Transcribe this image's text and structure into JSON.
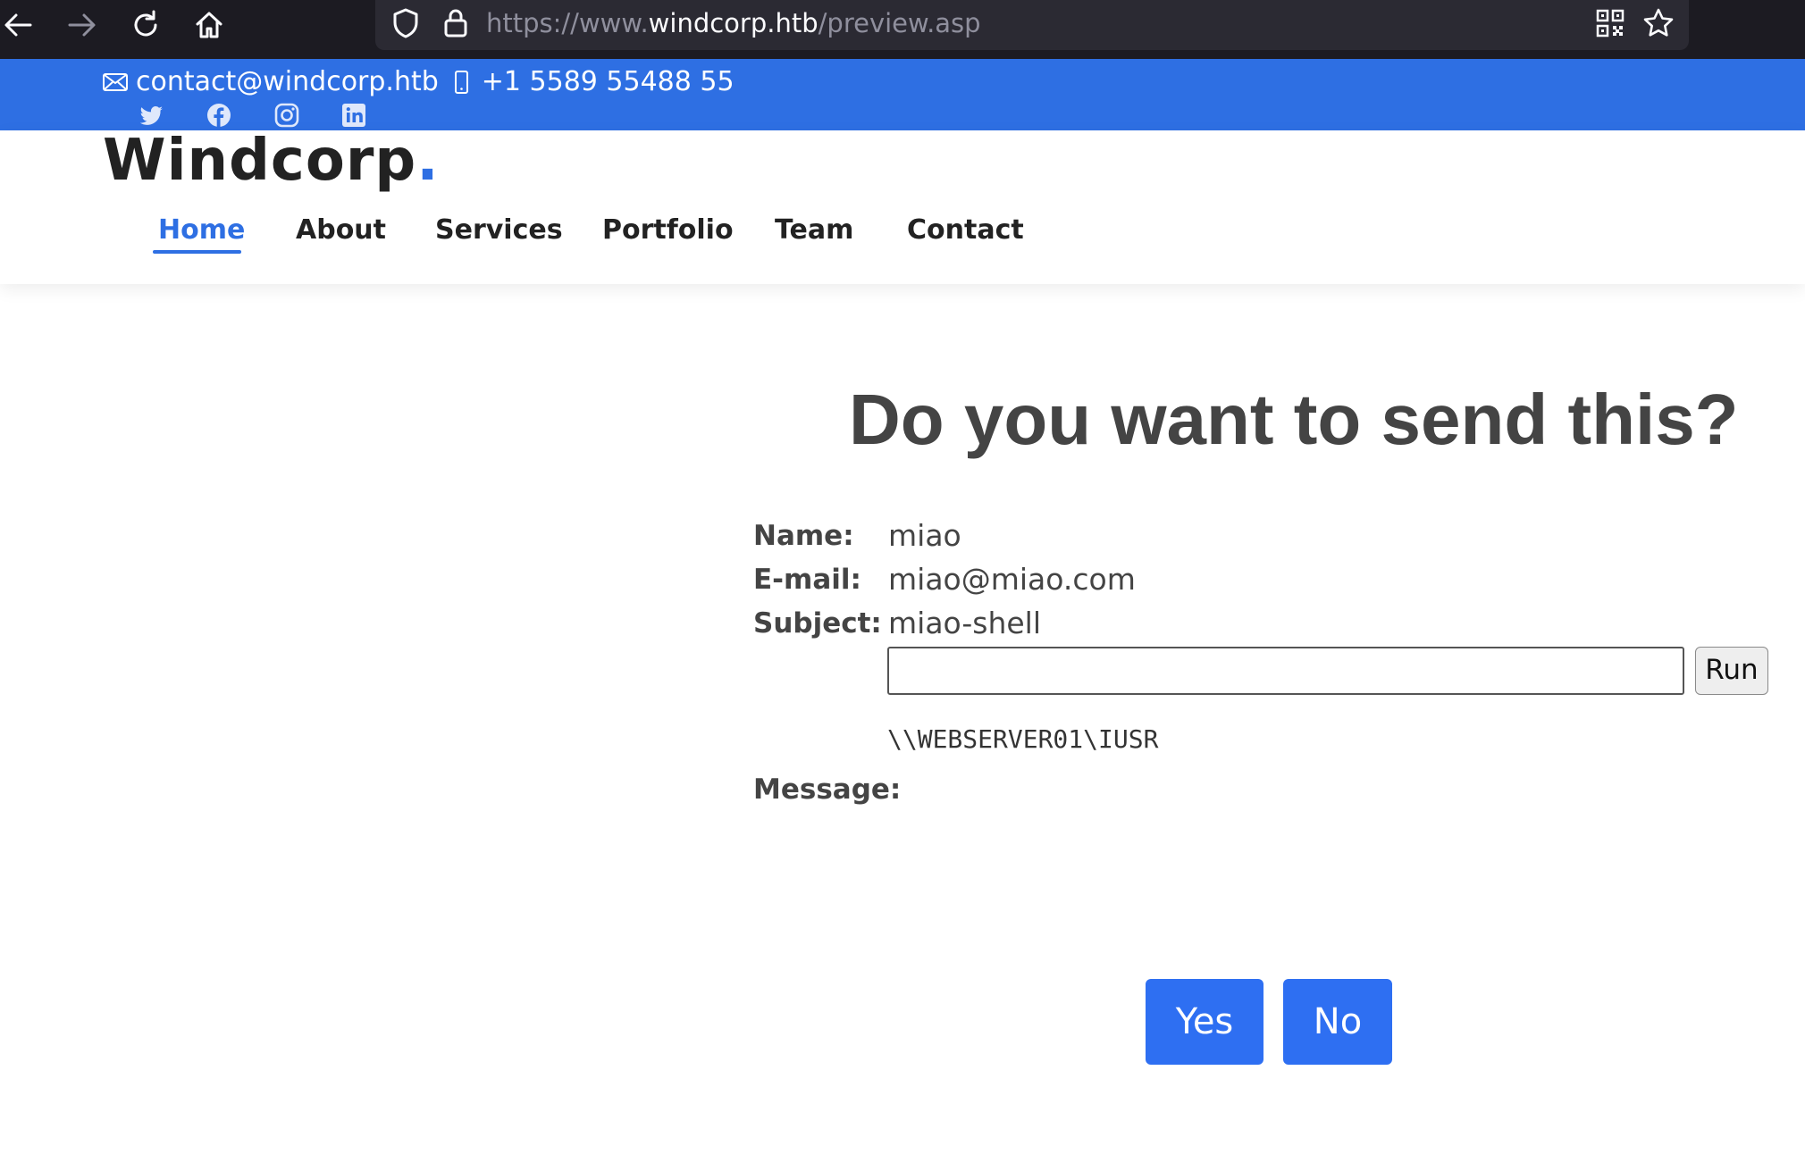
{
  "browser": {
    "url_prefix": "https://www.",
    "url_host": "windcorp.htb",
    "url_path": "/preview.asp"
  },
  "topbar": {
    "email": "contact@windcorp.htb",
    "phone": "+1 5589 55488 55",
    "social_icons": [
      "twitter-icon",
      "facebook-icon",
      "instagram-icon",
      "linkedin-icon"
    ]
  },
  "header": {
    "logo": "Windcorp",
    "logo_dot": ".",
    "nav": [
      "Home",
      "About",
      "Services",
      "Portfolio",
      "Team",
      "Contact"
    ],
    "active_nav": "Home"
  },
  "main": {
    "heading": "Do you want to send this?",
    "fields": {
      "name_label": "Name:",
      "name_value": "miao",
      "email_label": "E-mail:",
      "email_value": "miao@miao.com",
      "subject_label": "Subject:",
      "subject_value": "miao-shell",
      "message_label": "Message:"
    },
    "command_input_value": "",
    "run_label": "Run",
    "command_output": "\\\\WEBSERVER01\\IUSR",
    "yes_label": "Yes",
    "no_label": "No"
  },
  "colors": {
    "accent": "#2e6fe3",
    "toolbar_bg": "#1c1b22",
    "urlbar_bg": "#2b2a33",
    "button_blue": "#2e6ff2",
    "text": "#444444"
  }
}
